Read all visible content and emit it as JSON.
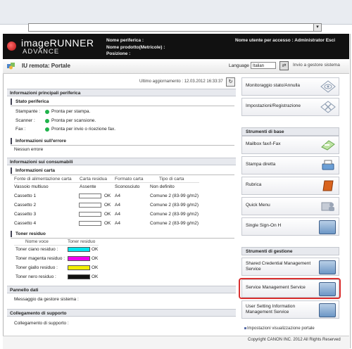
{
  "header": {
    "brand_line1": "imageRUNNER",
    "brand_line2": "ADVANCE",
    "device_name_label": "Nome periferica :",
    "product_name_label": "Nome prodotto(Metricole) :",
    "position_label": "Posizione :",
    "login_user": "Nome utente per accesso : Administrator Esci"
  },
  "subbar": {
    "title": "IU remota: Portale",
    "language_label": "Language",
    "language_value": "Italian",
    "admin_link": "Invio a gestore sistema"
  },
  "main": {
    "last_update": "Ultimo aggiornamento : 12.03.2012 16:33:37",
    "device_info_header": "Informazioni principali periferica",
    "device_status_header": "Stato periferica",
    "statuses": [
      {
        "label": "Stampante :",
        "value": "Pronta per stampa."
      },
      {
        "label": "Scanner :",
        "value": "Pronta per scansione."
      },
      {
        "label": "Fax :",
        "value": "Pronta per invio o ricezione fax."
      }
    ],
    "error_header": "Informazioni sull'errore",
    "error_value": "Nessun errore",
    "consumables_header": "Informazioni sui consumabili",
    "paper_header": "Informazioni carta",
    "paper_columns": [
      "Fonte di alimentazione carta",
      "Carta residua",
      "Formato carta",
      "Tipo di carta"
    ],
    "paper_rows": [
      {
        "source": "Vassoio multiuso",
        "status": "Assente",
        "format": "Sconosciuto",
        "type": "Non definito",
        "level": null
      },
      {
        "source": "Cassetto 1",
        "status": "OK",
        "format": "A4",
        "type": "Comune 2 (83-99 g/m2)",
        "level": 0
      },
      {
        "source": "Cassetto 2",
        "status": "OK",
        "format": "A4",
        "type": "Comune 2 (83-99 g/m2)",
        "level": 0
      },
      {
        "source": "Cassetto 3",
        "status": "OK",
        "format": "A4",
        "type": "Comune 2 (83-99 g/m2)",
        "level": 0
      },
      {
        "source": "Cassetto 4",
        "status": "OK",
        "format": "A4",
        "type": "Comune 2 (83-99 g/m2)",
        "level": 0
      }
    ],
    "toner_header": "Toner residuo",
    "toner_columns": [
      "Nome voce",
      "Toner residuo"
    ],
    "toner_rows": [
      {
        "label": "Toner ciano residuo :",
        "status": "OK",
        "color": "#00e5ee"
      },
      {
        "label": "Toner magenta residuo :",
        "status": "OK",
        "color": "#ee00ee"
      },
      {
        "label": "Toner giallo residuo :",
        "status": "OK",
        "color": "#f2ef00"
      },
      {
        "label": "Toner nero residuo :",
        "status": "OK",
        "color": "#111111"
      }
    ],
    "panel_header": "Pannello dati",
    "panel_value": "Messaggio da gestore sistema :",
    "support_header": "Collegamento di supporto",
    "support_value": "Collegamento di supporto :"
  },
  "right": {
    "top_buttons": [
      "Monitoraggio stato/Annulla",
      "Impostazioni/Registrazione"
    ],
    "basic_header": "Strumenti di base",
    "basic_buttons": [
      "Mailbox fax/I-Fax",
      "Stampa diretta",
      "Rubrica",
      "Quick Menu",
      "Single Sign-On H"
    ],
    "mgmt_header": "Strumenti di gestione",
    "mgmt_buttons": [
      "Shared Credential Management Service",
      "Service Management Service",
      "User Setting Information Management Service"
    ],
    "portal_settings_link": "Impostazioni visualizzazione portale"
  },
  "footer": {
    "copyright": "Copyright CANON INC. 2012 All Rights Reserved"
  }
}
